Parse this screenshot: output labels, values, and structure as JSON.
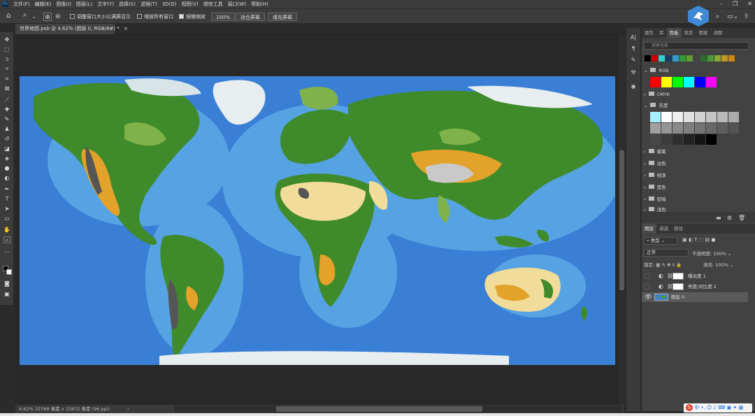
{
  "menubar": {
    "app_logo": "Ps",
    "menus": [
      "文件(F)",
      "编辑(E)",
      "图像(I)",
      "图层(L)",
      "文字(Y)",
      "选择(S)",
      "滤镜(T)",
      "3D(D)",
      "视图(V)",
      "增效工具",
      "窗口(W)",
      "帮助(H)"
    ],
    "window_controls": [
      "–",
      "❐",
      "✕"
    ]
  },
  "optionsbar": {
    "resize_windows": "调整窗口大小以满屏显示",
    "zoom_all": "缩放所有窗口",
    "scrubby_zoom": "细微缩放",
    "zoom_value": "100%",
    "fit_screen": "适合屏幕",
    "fill_screen": "填充屏幕",
    "right_icons": [
      "search-icon",
      "workspace-icon",
      "share-icon"
    ]
  },
  "document": {
    "tab_title": "世界地图.psb @ 4.62% (图层 0, RGB/8#) *",
    "close": "×"
  },
  "status": {
    "zoom": "4.62%",
    "dimensions": "32768 像素 x 15872 像素 (96 ppi)",
    "arrow": "›"
  },
  "swatches_panel": {
    "tabs": [
      "属性",
      "库",
      "色板",
      "渐变",
      "图案",
      "调整"
    ],
    "active_tab": "色板",
    "search_placeholder": "搜索色板",
    "recent": [
      "#000000",
      "#cc0000",
      "#33cccc",
      "#1a3a66",
      "#3399cc",
      "#339933",
      "#669933",
      "#444444",
      "#2d6b2d",
      "#4a9a3a",
      "#88aa33",
      "#bb9922",
      "#cc8811"
    ],
    "groups": [
      {
        "name": "RGB",
        "open": true
      },
      {
        "name": "CMYK",
        "open": false
      },
      {
        "name": "灰度",
        "open": true
      },
      {
        "name": "蜡笔",
        "open": false
      },
      {
        "name": "淡色",
        "open": false
      },
      {
        "name": "纯净",
        "open": false
      },
      {
        "name": "黑色",
        "open": false
      },
      {
        "name": "较暗",
        "open": false
      },
      {
        "name": "浅色",
        "open": false
      }
    ],
    "rgb_colors": [
      "#ff0000",
      "#ffff00",
      "#00ff00",
      "#00ffff",
      "#0000ff",
      "#ff00ff"
    ],
    "gray_colors": [
      "#a6f0ff",
      "#ffffff",
      "#eeeeee",
      "#e0e0e0",
      "#d0d0d0",
      "#c4c4c4",
      "#b8b8b8",
      "#ababab",
      "#a0a0a0",
      "#959595",
      "#8a8a8a",
      "#7f7f7f",
      "#747474",
      "#696969",
      "#5e5e5e",
      "#535353",
      "#484848",
      "#3c3c3c",
      "#2f2f2f",
      "#232323",
      "#141414",
      "#000000"
    ]
  },
  "layers_panel": {
    "tabs": [
      "图层",
      "通道",
      "路径"
    ],
    "active_tab": "图层",
    "filter_label": "类型",
    "blend_mode": "正常",
    "opacity_label": "不透明度:",
    "opacity_value": "100%",
    "lock_label": "锁定:",
    "fill_label": "填充:",
    "fill_value": "100%",
    "layers": [
      {
        "name": "曝光度 1",
        "visible": false,
        "selected": false
      },
      {
        "name": "亮度/对比度 2",
        "visible": false,
        "selected": false
      },
      {
        "name": "图层 0",
        "visible": true,
        "selected": true
      }
    ]
  },
  "ime": {
    "logo": "S",
    "text": "中 •, ☺ ♪ ⌨ ▣ ✦ ▦"
  },
  "colors": {
    "ocean": "#3a7fd6",
    "ocean_shallow": "#5aa7e6",
    "land_green": "#3f8a2a",
    "land_light_green": "#7fb24a",
    "desert": "#f2dc9a",
    "orange": "#e3a22a",
    "mountain": "#555555",
    "ice": "#e8eef0"
  }
}
